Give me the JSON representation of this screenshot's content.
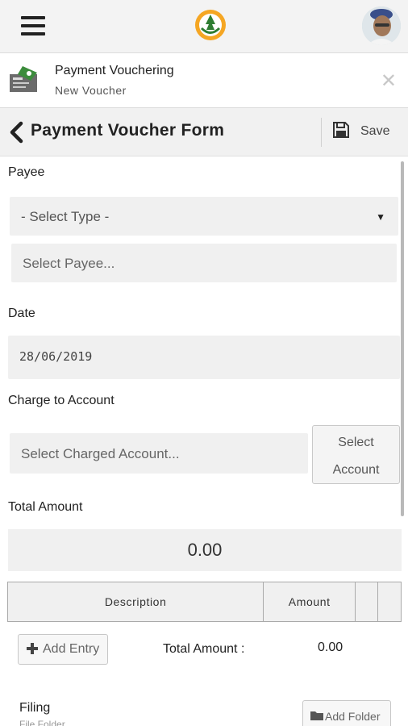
{
  "topbar": {
    "menu_icon": "hamburger-icon",
    "logo_icon": "app-logo",
    "avatar_icon": "user-avatar"
  },
  "module": {
    "title": "Payment Vouchering",
    "subtitle": "New Voucher",
    "close_icon": "close-icon"
  },
  "form": {
    "title": "Payment Voucher Form",
    "save_label": "Save"
  },
  "payee": {
    "label": "Payee",
    "type_select": "- Select Type -",
    "payee_placeholder": "Select Payee..."
  },
  "date": {
    "label": "Date",
    "value": "28/06/2019"
  },
  "charge": {
    "label": "Charge to Account",
    "placeholder": "Select Charged Account...",
    "button_line1": "Select",
    "button_line2": "Account"
  },
  "total": {
    "label": "Total Amount",
    "value": "0.00"
  },
  "entries_table": {
    "columns": [
      "Description",
      "Amount",
      "",
      ""
    ]
  },
  "footer": {
    "add_entry": "Add Entry",
    "total_label": "Total Amount :",
    "total_value": "0.00"
  },
  "filing": {
    "label": "Filing",
    "sub": "File Folder",
    "add_folder": "Add Folder"
  }
}
